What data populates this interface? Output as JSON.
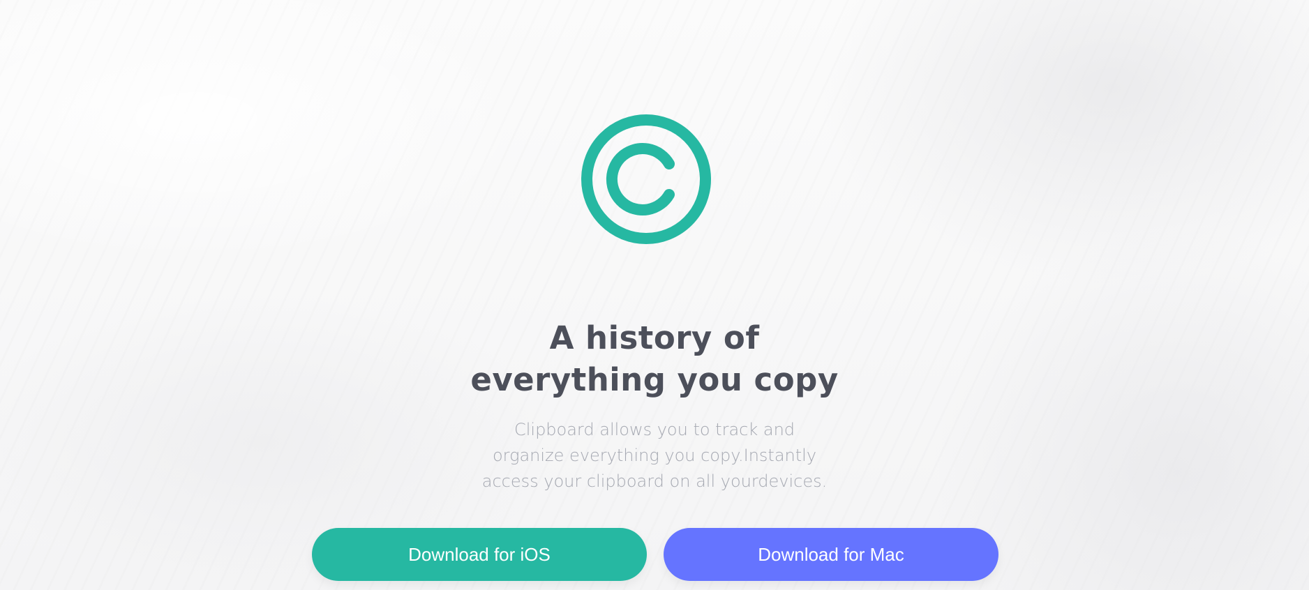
{
  "hero": {
    "logo_icon": "clipboard-copyright-icon",
    "headline_line1": "A history of",
    "headline_line2": "everything you copy",
    "description_line1": "Clipboard allows you to track and",
    "description_line2": "organize everything you copy.Instantly",
    "description_line3": "access your clipboard on all yourdevices."
  },
  "buttons": {
    "ios_label": "Download for iOS",
    "mac_label": "Download for Mac"
  },
  "colors": {
    "accent": "#26b8a2",
    "secondary": "#6574ff",
    "heading": "#4c4f5a",
    "body_text": "#a5a8b1"
  }
}
